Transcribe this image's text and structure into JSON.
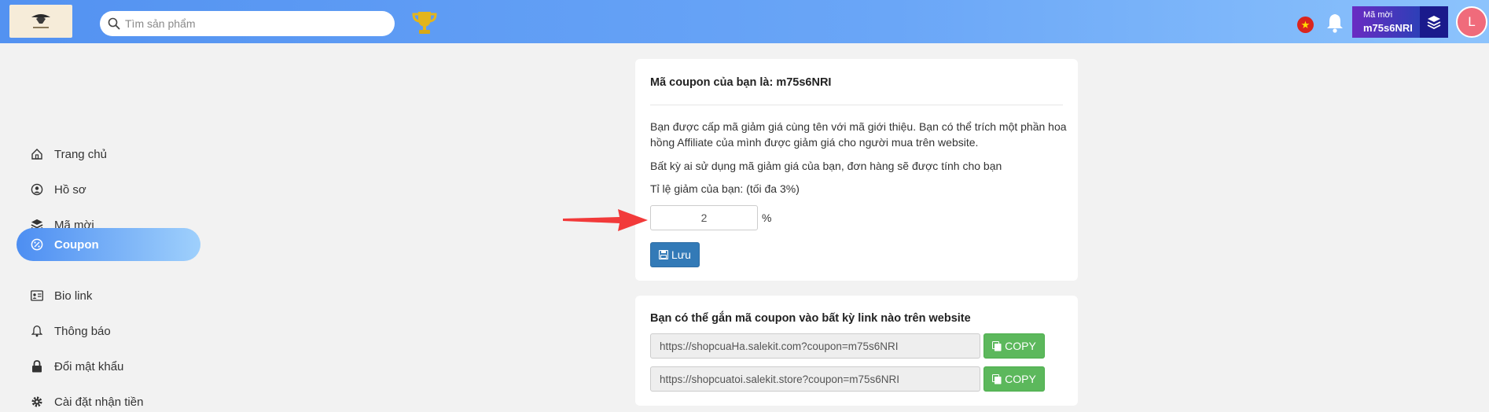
{
  "header": {
    "search_placeholder": "Tìm sản phẩm",
    "invite_label": "Mã mời",
    "invite_code": "m75s6NRI",
    "avatar_letter": "L"
  },
  "sidebar": {
    "items": [
      {
        "label": "Trang chủ",
        "icon": "home-icon"
      },
      {
        "label": "Hồ sơ",
        "icon": "user-circle-icon"
      },
      {
        "label": "Mã mời",
        "icon": "layers-icon"
      },
      {
        "label": "Coupon",
        "icon": "percent-badge-icon",
        "active": true
      },
      {
        "label": "Bio link",
        "icon": "id-card-icon"
      },
      {
        "label": "Thông báo",
        "icon": "bell-icon"
      },
      {
        "label": "Đổi mật khẩu",
        "icon": "lock-icon"
      },
      {
        "label": "Cài đặt nhận tiền",
        "icon": "gear-icon"
      }
    ]
  },
  "coupon_card": {
    "title": "Mã coupon của bạn là: m75s6NRI",
    "desc1": "Bạn được cấp mã giảm giá cùng tên với mã giới thiệu. Bạn có thể trích một phần hoa hồng Affiliate của mình được giảm giá cho người mua trên website.",
    "desc2": "Bất kỳ ai sử dụng mã giảm giá của bạn, đơn hàng sẽ được tính cho bạn",
    "rate_label": "Tỉ lệ giảm của bạn: (tối đa 3%)",
    "rate_value": "2",
    "percent_sign": "%",
    "save_label": "Lưu"
  },
  "links_card": {
    "title": "Bạn có thể gắn mã coupon vào bất kỳ link nào trên website",
    "links": [
      {
        "url": "https://shopcuaHa.salekit.com?coupon=m75s6NRI",
        "copy_label": "COPY"
      },
      {
        "url": "https://shopcuatoi.salekit.store?coupon=m75s6NRI",
        "copy_label": "COPY"
      }
    ]
  },
  "colors": {
    "header_start": "#5392f1",
    "header_end": "#8cc3fc",
    "save_button": "#337ab7",
    "copy_button": "#5cb85c",
    "arrow": "#f23a3a"
  }
}
